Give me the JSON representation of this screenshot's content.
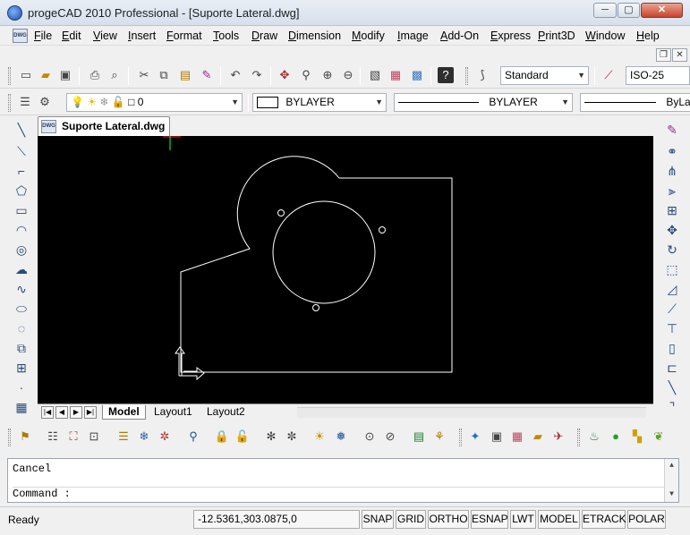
{
  "window": {
    "title": "progeCAD 2010 Professional - [Suporte Lateral.dwg]",
    "min_label": "─",
    "max_label": "▢",
    "close_label": "✕"
  },
  "menu": {
    "items": [
      "File",
      "Edit",
      "View",
      "Insert",
      "Format",
      "Tools",
      "Draw",
      "Dimension",
      "Modify",
      "Image",
      "Add-On",
      "Express",
      "Print3D",
      "Window",
      "Help"
    ],
    "doc_icon": "DWG",
    "mdi_min": "─",
    "mdi_restore": "❐",
    "mdi_close": "✕"
  },
  "toolbar_standard": {
    "text_style": "Standard",
    "dim_style": "ISO-25"
  },
  "toolbar_properties": {
    "layer": "0",
    "color": "BYLAYER",
    "linetype": "BYLAYER",
    "lineweight": "ByLa"
  },
  "drawing": {
    "tab_label": "Suporte Lateral.dwg",
    "tab_icon": "DWG",
    "background": "#000000",
    "stroke_color": "#ffffff",
    "cursor_color_x": "#ff2020",
    "cursor_color_y": "#20ff20"
  },
  "layout_tabs": {
    "nav": [
      "|◀",
      "◀",
      "▶",
      "▶|"
    ],
    "tabs": [
      "Model",
      "Layout1",
      "Layout2"
    ],
    "active": "Model"
  },
  "command": {
    "history": "Cancel",
    "prompt": "Command :",
    "scroll_up": "▲",
    "scroll_down": "▼"
  },
  "status": {
    "ready": "Ready",
    "coordinates": "-12.5361,303.0875,0",
    "buttons": [
      "SNAP",
      "GRID",
      "ORTHO",
      "ESNAP",
      "LWT",
      "MODEL",
      "ETRACK",
      "POLAR"
    ]
  }
}
